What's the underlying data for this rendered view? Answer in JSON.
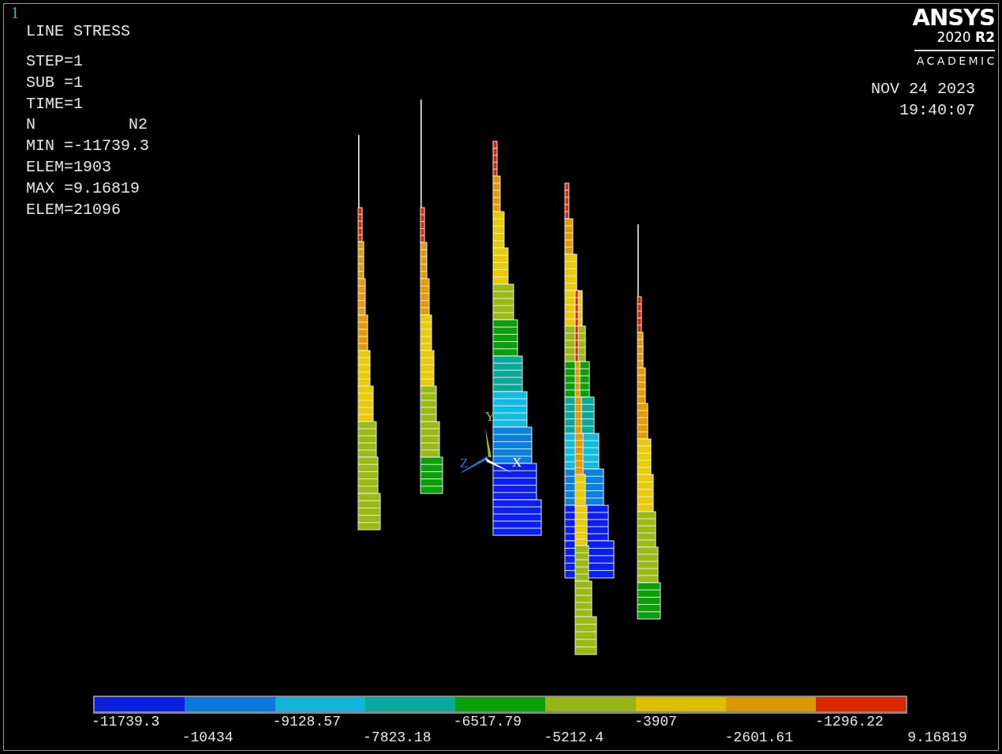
{
  "window_number": "1",
  "title": "LINE STRESS",
  "info_lines": [
    {
      "text": "STEP=1"
    },
    {
      "text": "SUB =1"
    },
    {
      "text": "TIME=1"
    },
    {
      "text": "N",
      "right": "N2"
    },
    {
      "text": "MIN =-11739.3"
    },
    {
      "text": "ELEM=1903"
    },
    {
      "text": "MAX =9.16819"
    },
    {
      "text": "ELEM=21096"
    }
  ],
  "logo": {
    "name": "ANSYS",
    "version": "2020 **R2**",
    "edition": "ACADEMIC"
  },
  "date": "NOV 24 2023",
  "time": "19:40:07",
  "triad": {
    "x_label": "X",
    "y_label": "Y",
    "z_label": "Z"
  },
  "legend": {
    "bands": [
      {
        "color": "#0a1ee0"
      },
      {
        "color": "#0a78dc"
      },
      {
        "color": "#12b4dc"
      },
      {
        "color": "#0aa89a"
      },
      {
        "color": "#0aa00a"
      },
      {
        "color": "#96b414"
      },
      {
        "color": "#dcc000"
      },
      {
        "color": "#dc9600"
      },
      {
        "color": "#dc2800"
      }
    ],
    "labels": [
      "-11739.3",
      "-10434",
      "-9128.57",
      "-7823.18",
      "-6517.79",
      "-5212.4",
      "-3907",
      "-2601.61",
      "-1296.22",
      "9.16819"
    ]
  }
}
